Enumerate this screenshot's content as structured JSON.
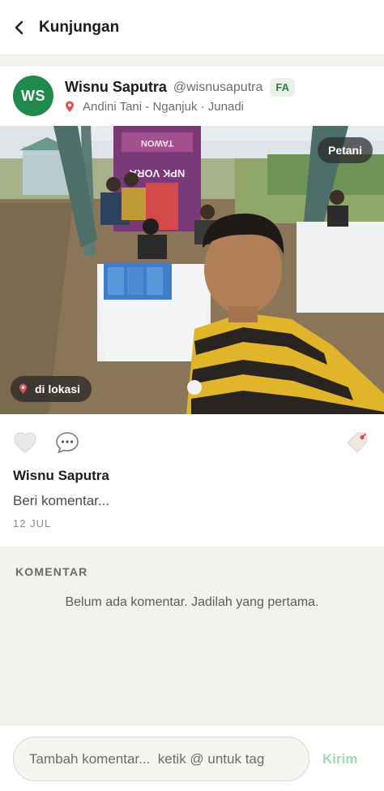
{
  "header": {
    "title": "Kunjungan"
  },
  "post": {
    "author": {
      "initials": "WS",
      "name": "Wisnu Saputra",
      "handle": "@wisnusaputra",
      "role_badge": "FA",
      "avatar_color": "#1f8a4c"
    },
    "location": "Andini Tani - Nganjuk · Junadi",
    "photo": {
      "category_badge": "Petani",
      "location_badge": "di lokasi",
      "banner_text": "NPK VORA",
      "brand_text": "TAWON"
    },
    "caption_name": "Wisnu Saputra",
    "caption_placeholder": "Beri komentar...",
    "date": "12 JUL",
    "liked": false
  },
  "comments": {
    "title": "KOMENTAR",
    "empty_message": "Belum ada komentar. Jadilah yang pertama."
  },
  "composer": {
    "placeholder": "Tambah komentar...  ketik @ untuk tag",
    "send_label": "Kirim",
    "send_color": "#9fd8b3"
  },
  "icons": {
    "back": "chevron-left-icon",
    "location": "map-pin-icon",
    "like": "heart-icon",
    "comment": "speech-bubble-icon",
    "tag": "tag-icon"
  }
}
